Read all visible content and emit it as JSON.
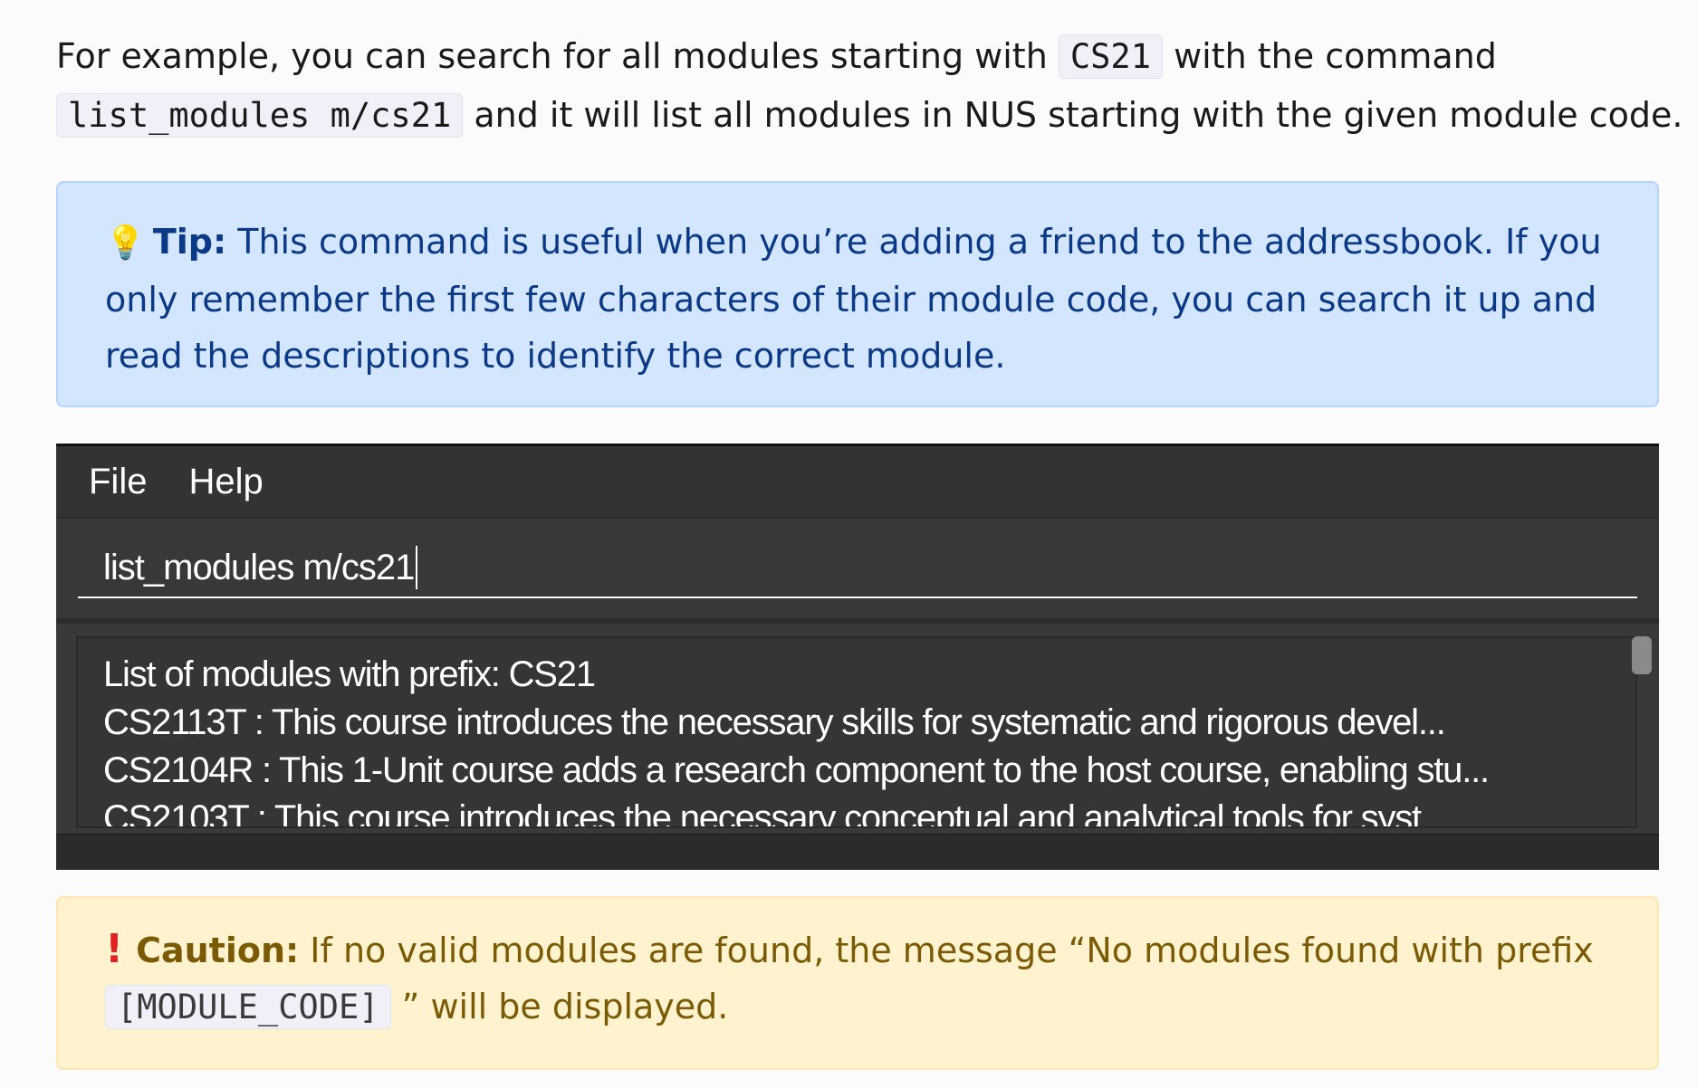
{
  "intro": {
    "text1": "For example, you can search for all modules starting with ",
    "code1": "CS21",
    "text2": " with the command ",
    "code2": "list_modules m/cs21",
    "text3": " and it will list all modules in NUS starting with the given module code."
  },
  "tip": {
    "icon": "lightbulb-icon",
    "label": "Tip:",
    "text": " This command is useful when you’re adding a friend to the addressbook. If you only remember the first few characters of their module code, you can search it up and read the descriptions to identify the correct module."
  },
  "app": {
    "menu": [
      "File",
      "Help"
    ],
    "command_value": "list_modules m/cs21",
    "result_lines": [
      "List of modules with prefix: CS21",
      "CS2113T : This course introduces the necessary skills for systematic and rigorous devel...",
      "CS2104R : This 1-Unit course adds a research component to the host course, enabling stu...",
      "CS2103T : This course introduces the necessary conceptual and analytical tools for syst"
    ]
  },
  "caution": {
    "icon": "exclamation-icon",
    "label": "Caution:",
    "text1": " If no valid modules are found, the message “No modules found with prefix ",
    "code": "[MODULE_CODE]",
    "text2": " ” will be displayed."
  },
  "colors": {
    "tip_bg": "#d4e6fd",
    "tip_text": "#0a3a86",
    "caution_bg": "#fff3cf",
    "caution_text": "#7a5a05",
    "app_bg": "#3c3c3c"
  }
}
